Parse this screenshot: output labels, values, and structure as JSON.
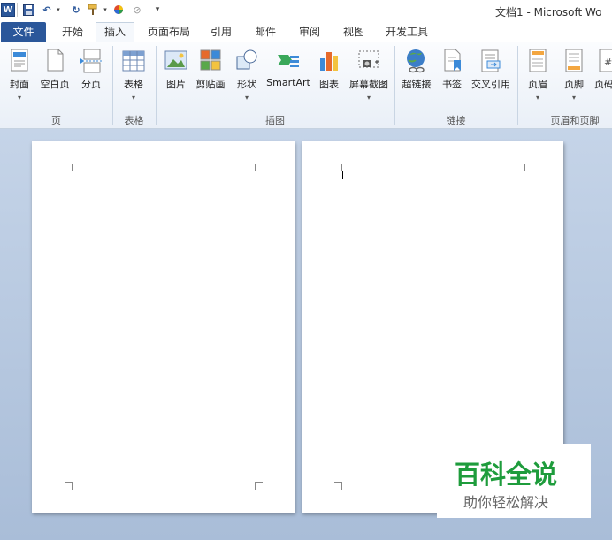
{
  "window": {
    "title": "文档1 - Microsoft Wo"
  },
  "tabs": [
    {
      "label": "文件"
    },
    {
      "label": "开始"
    },
    {
      "label": "插入"
    },
    {
      "label": "页面布局"
    },
    {
      "label": "引用"
    },
    {
      "label": "邮件"
    },
    {
      "label": "审阅"
    },
    {
      "label": "视图"
    },
    {
      "label": "开发工具"
    }
  ],
  "ribbon": {
    "buttons": {
      "cover": "封面",
      "blank": "空白页",
      "pagebreak": "分页",
      "table": "表格",
      "picture": "图片",
      "clipart": "剪贴画",
      "shapes": "形状",
      "smartart": "SmartArt",
      "chart": "图表",
      "screenshot": "屏幕截图",
      "hyperlink": "超链接",
      "bookmark": "书签",
      "crossref": "交叉引用",
      "header": "页眉",
      "footer": "页脚",
      "pagenum": "页码"
    },
    "groups": {
      "pages": "页",
      "tables": "表格",
      "illustrations": "插图",
      "links": "链接",
      "headerfooter": "页眉和页脚"
    }
  },
  "watermark": {
    "title": "百科全说",
    "subtitle": "助你轻松解决"
  },
  "colors": {
    "file_tab": "#2b579a",
    "workspace": "#b8cae2",
    "watermark_green": "#1e9c3c"
  },
  "icons": [
    "word-logo-icon",
    "save-icon",
    "undo-icon",
    "redo-icon",
    "format-painter-icon",
    "color-icon",
    "clear-icon",
    "customize-arrow-icon"
  ]
}
